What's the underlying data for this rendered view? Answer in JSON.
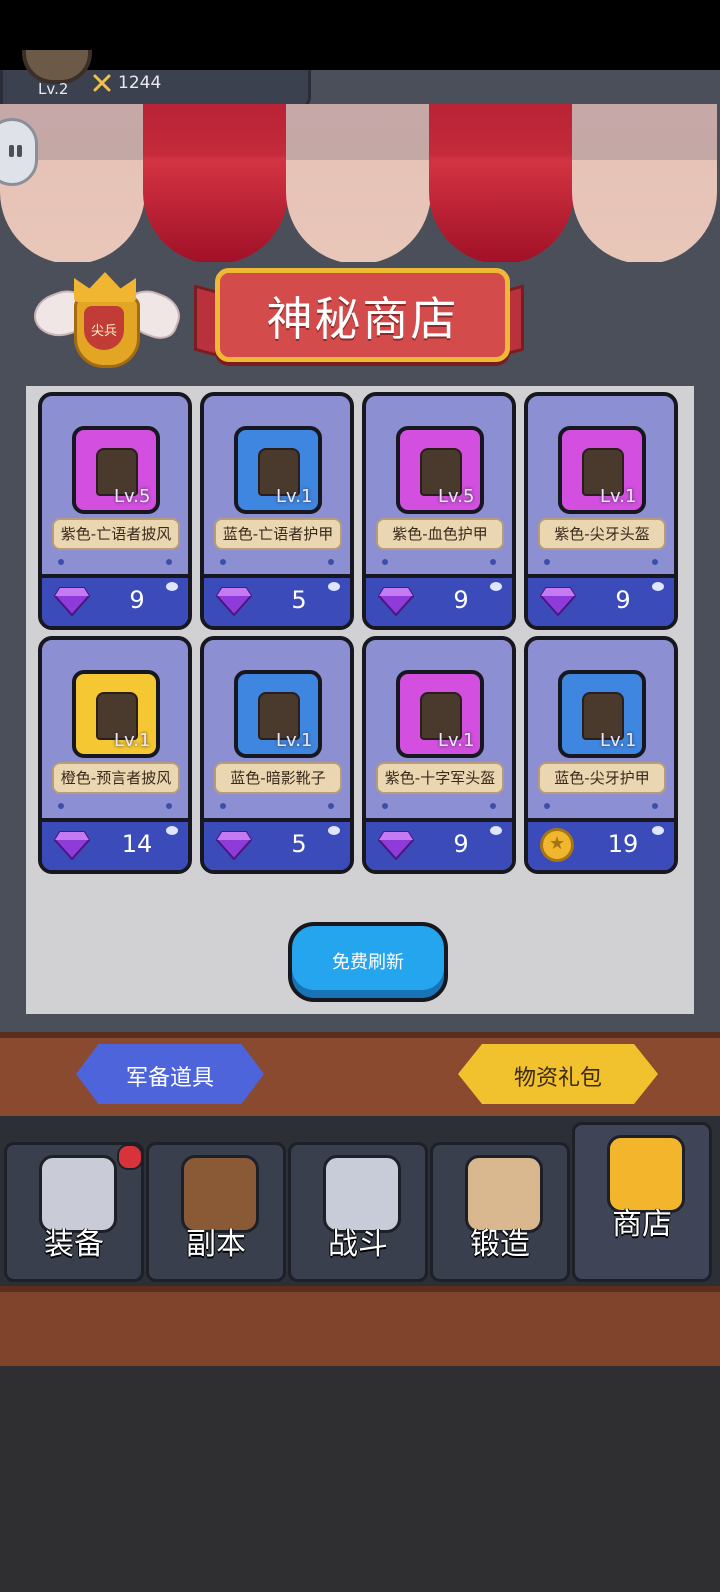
{
  "player": {
    "level": "Lv.2",
    "power": "1244"
  },
  "shop": {
    "title": "神秘商店",
    "rank_badge": "尖兵"
  },
  "items": [
    {
      "name": "紫色-亡语者披风",
      "level": "Lv.5",
      "price": "9",
      "currency": "gem",
      "rarity": "purple"
    },
    {
      "name": "蓝色-亡语者护甲",
      "level": "Lv.1",
      "price": "5",
      "currency": "gem",
      "rarity": "blue"
    },
    {
      "name": "紫色-血色护甲",
      "level": "Lv.5",
      "price": "9",
      "currency": "gem",
      "rarity": "purple"
    },
    {
      "name": "紫色-尖牙头盔",
      "level": "Lv.1",
      "price": "9",
      "currency": "gem",
      "rarity": "purple"
    },
    {
      "name": "橙色-预言者披风",
      "level": "Lv.1",
      "price": "14",
      "currency": "gem",
      "rarity": "orange"
    },
    {
      "name": "蓝色-暗影靴子",
      "level": "Lv.1",
      "price": "5",
      "currency": "gem",
      "rarity": "blue"
    },
    {
      "name": "紫色-十字军头盔",
      "level": "Lv.1",
      "price": "9",
      "currency": "gem",
      "rarity": "purple"
    },
    {
      "name": "蓝色-尖牙护甲",
      "level": "Lv.1",
      "price": "19",
      "currency": "coin",
      "rarity": "blue"
    }
  ],
  "refresh_label": "免费刷新",
  "tabs": {
    "military": "军备道具",
    "supplies": "物资礼包"
  },
  "nav": [
    {
      "label": "装备",
      "icon": "helmet-icon"
    },
    {
      "label": "副本",
      "icon": "dungeon-sword-icon"
    },
    {
      "label": "战斗",
      "icon": "crossed-swords-icon"
    },
    {
      "label": "锻造",
      "icon": "forge-scroll-icon"
    },
    {
      "label": "商店",
      "icon": "shop-icon",
      "active": true
    }
  ],
  "colors": {
    "purple": "#d24fe0",
    "blue": "#3f86e0",
    "orange": "#f5c732",
    "gem": "#8f3bd9",
    "price_bar": "#3b4bb9"
  }
}
